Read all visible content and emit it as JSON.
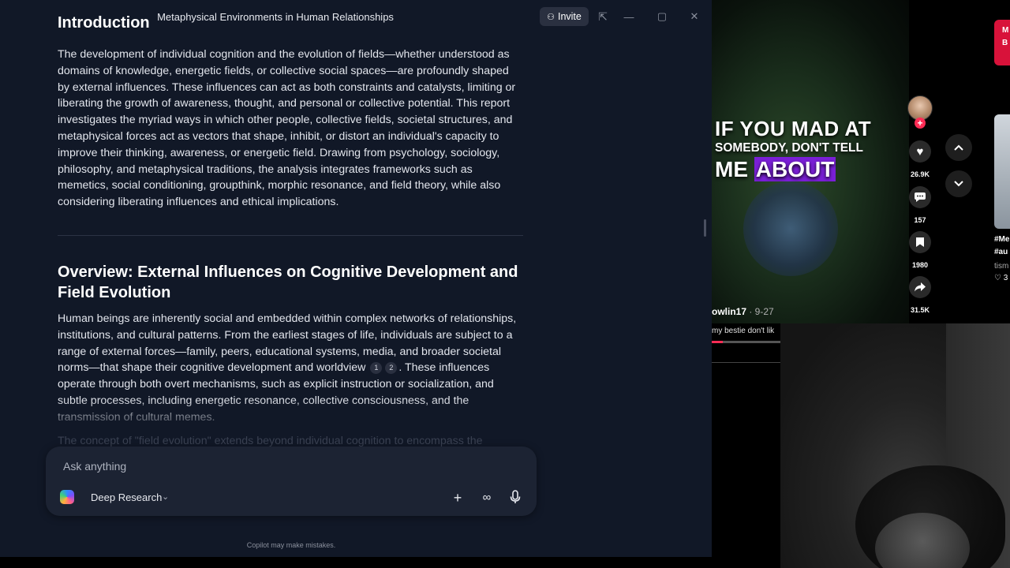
{
  "copilot": {
    "window_title": "Metaphysical Environments in Human Relationships",
    "invite_label": "Invite",
    "intro_heading": "Introduction",
    "intro_paragraph": "The development of individual cognition and the evolution of fields—whether understood as domains of knowledge, energetic fields, or collective social spaces—are profoundly shaped by external influences. These influences can act as both constraints and catalysts, limiting or liberating the growth of awareness, thought, and personal or collective potential. This report investigates the myriad ways in which other people, collective fields, societal structures, and metaphysical forces act as vectors that shape, inhibit, or distort an individual's capacity to improve their thinking, awareness, or energetic field. Drawing from psychology, sociology, philosophy, and metaphysical traditions, the analysis integrates frameworks such as memetics, social conditioning, groupthink, morphic resonance, and field theory, while also considering liberating influences and ethical implications.",
    "overview_heading": "Overview: External Influences on Cognitive Development and Field Evolution",
    "overview_part1": "Human beings are inherently social and embedded within complex networks of relationships, institutions, and cultural patterns. From the earliest stages of life, individuals are subject to a range of external forces—family, peers, educational systems, media, and broader societal norms—that shape their cognitive development and worldview",
    "citation_1": "1",
    "citation_2": "2",
    "overview_part2": ". These influences operate through both overt mechanisms, such as explicit instruction or socialization, and subtle processes, including energetic resonance, collective consciousness, and the transmission of cultural memes.",
    "faded_paragraph": "The concept of \"field evolution\" extends beyond individual cognition to encompass the",
    "composer": {
      "placeholder": "Ask anything",
      "mode_label": "Deep Research"
    },
    "footer_note": "Copilot may make mistakes."
  },
  "tiktok": {
    "caption_line1": "IF YOU MAD AT",
    "caption_line2": "SOMEBODY, DON'T TELL",
    "caption_line3a": "ME ",
    "caption_line3b": "ABOUT",
    "username": "owlin17",
    "date": " · 9-27",
    "description": "my bestie don't lik",
    "likes": "26.9K",
    "comments": "157",
    "saves": "1980",
    "shares": "31.5K",
    "side_red_text": "M B",
    "side_tags": "#Me",
    "side_tags2": "#au",
    "side_user": "tism",
    "side_likes": "♡ 3",
    "progress_fraction": 0.16
  },
  "icons": {
    "heart": "heart-icon",
    "comment": "comment-icon",
    "bookmark": "bookmark-icon",
    "share": "share-icon"
  },
  "colors": {
    "copilot_bg": "#111827",
    "tiktok_accent": "#fe2c55",
    "caption_highlight": "#7a1fd6"
  }
}
